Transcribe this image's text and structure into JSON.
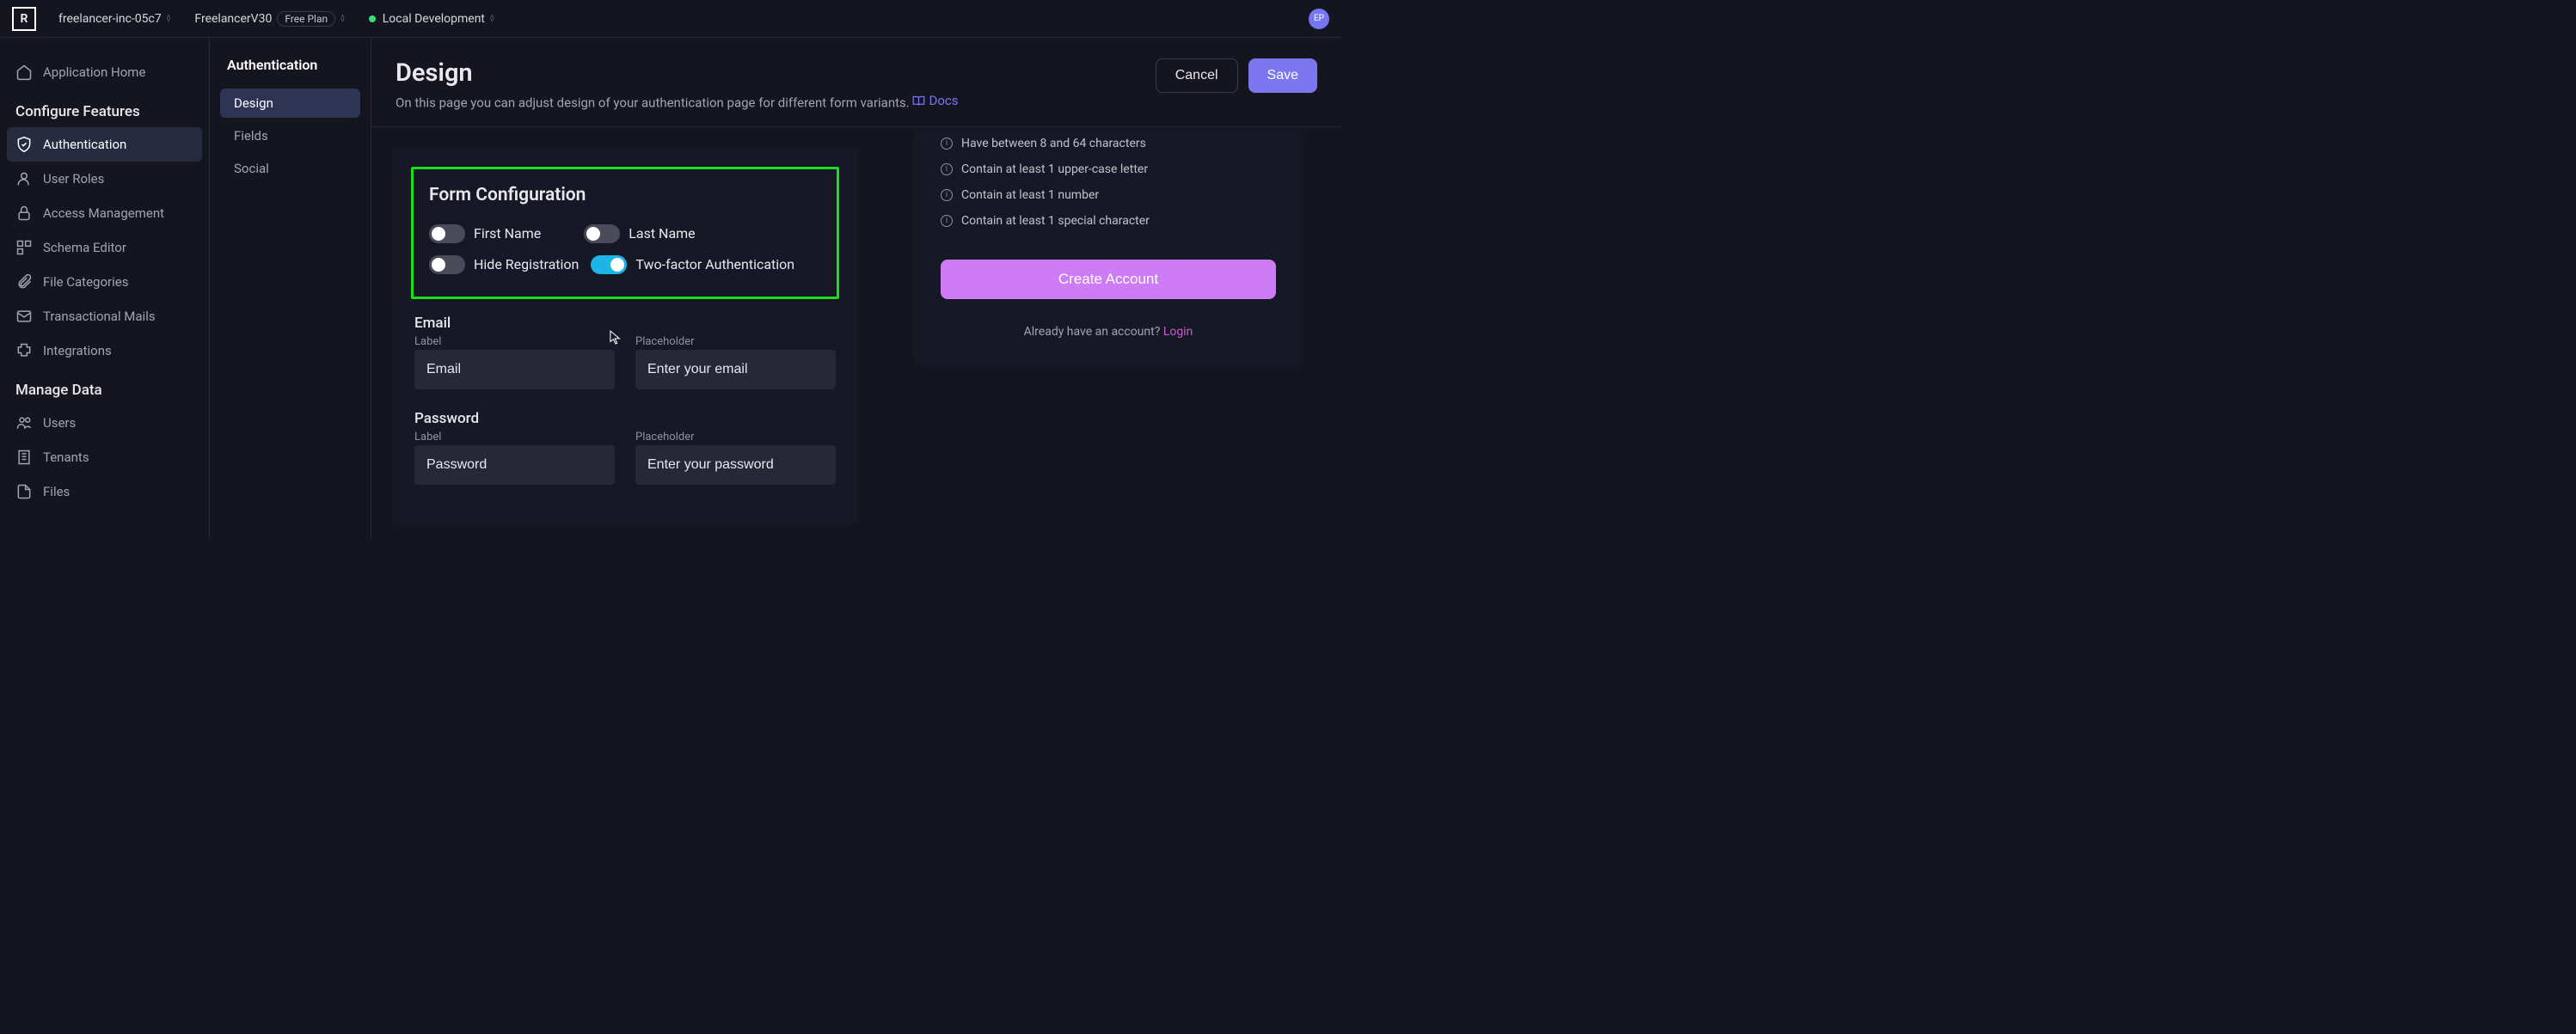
{
  "topbar": {
    "org": "freelancer-inc-05c7",
    "app": "FreelancerV30",
    "plan": "Free Plan",
    "env": "Local Development",
    "avatar": "EP"
  },
  "sidebar": {
    "home": "Application Home",
    "section_configure": "Configure Features",
    "items_configure": [
      {
        "label": "Authentication",
        "active": true
      },
      {
        "label": "User Roles"
      },
      {
        "label": "Access Management"
      },
      {
        "label": "Schema Editor"
      },
      {
        "label": "File Categories"
      },
      {
        "label": "Transactional Mails"
      },
      {
        "label": "Integrations"
      }
    ],
    "section_manage": "Manage Data",
    "items_manage": [
      {
        "label": "Users"
      },
      {
        "label": "Tenants"
      },
      {
        "label": "Files"
      }
    ]
  },
  "subnav": {
    "title": "Authentication",
    "items": [
      {
        "label": "Design",
        "active": true
      },
      {
        "label": "Fields"
      },
      {
        "label": "Social"
      }
    ]
  },
  "header": {
    "title": "Design",
    "subtitle": "On this page you can adjust design of your authentication page for different form variants.",
    "docs": "Docs",
    "cancel": "Cancel",
    "save": "Save"
  },
  "form_config": {
    "title": "Form Configuration",
    "toggles": {
      "first_name": "First Name",
      "last_name": "Last Name",
      "hide_registration": "Hide Registration",
      "two_factor": "Two-factor Authentication"
    },
    "fields": {
      "email": {
        "title": "Email",
        "label_label": "Label",
        "label_value": "Email",
        "placeholder_label": "Placeholder",
        "placeholder_value": "Enter your email"
      },
      "password": {
        "title": "Password",
        "label_label": "Label",
        "label_value": "Password",
        "placeholder_label": "Placeholder",
        "placeholder_value": "Enter your password"
      }
    }
  },
  "preview": {
    "requirements": [
      "Have between 8 and 64 characters",
      "Contain at least 1 upper-case letter",
      "Contain at least 1 number",
      "Contain at least 1 special character"
    ],
    "create_button": "Create Account",
    "already_prompt": "Already have an account? ",
    "login": "Login"
  }
}
